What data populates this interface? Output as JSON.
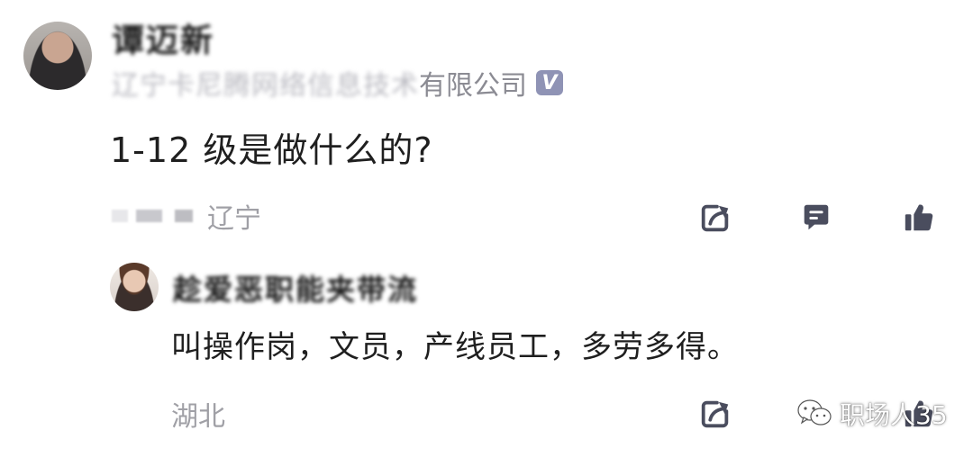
{
  "main_comment": {
    "author_name": "谭迈新",
    "company_obscured": "辽宁卡尼腾网络信息技术",
    "company_visible": "有限公司",
    "verified_badge": "V",
    "text": "1-12 级是做什么的?",
    "date_obscured": "",
    "location": "辽宁"
  },
  "reply": {
    "author_name": "趁爱恶职能夹带流",
    "text": "叫操作岗，文员，产线员工，多劳多得。",
    "location": "湖北"
  },
  "watermark": {
    "text": "职场人35"
  },
  "colors": {
    "meta_gray": "#a0a0a6",
    "icon_dark": "#4a4d5e",
    "badge": "#8f93b5"
  },
  "icons": [
    "share-icon",
    "comment-icon",
    "like-icon",
    "wechat-icon"
  ]
}
